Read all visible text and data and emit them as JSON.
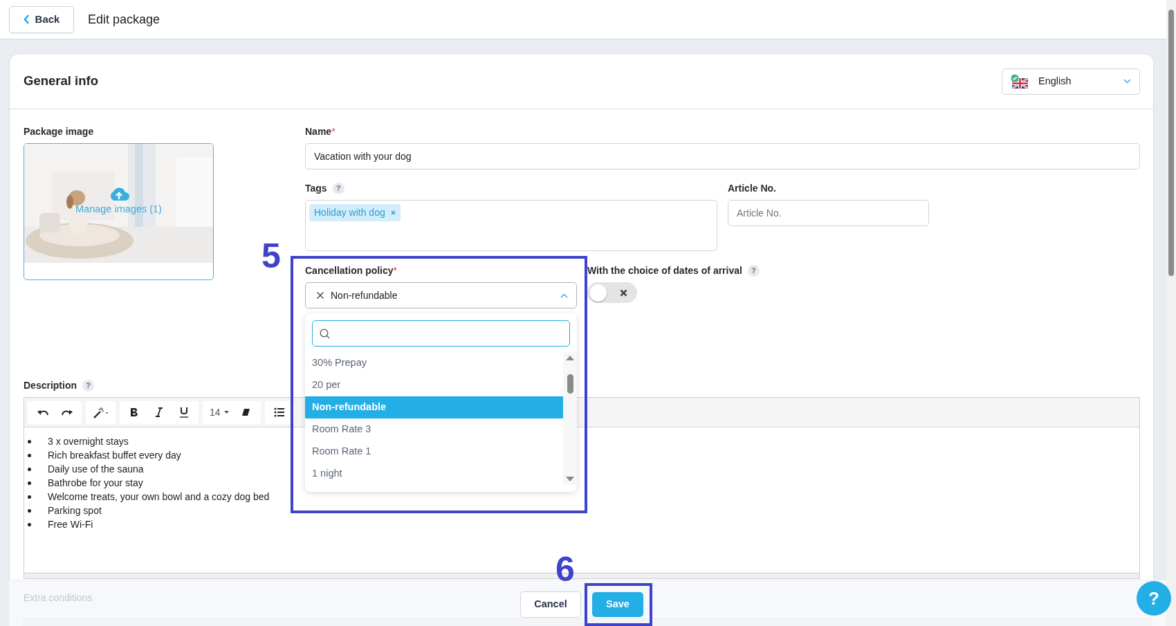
{
  "header": {
    "back_button": "Back",
    "title": "Edit package"
  },
  "card": {
    "title": "General info",
    "language": "English"
  },
  "package_image": {
    "label": "Package image",
    "link": "Manage images (1)"
  },
  "name": {
    "label": "Name",
    "required_mark": "*",
    "value": "Vacation with your dog"
  },
  "tags": {
    "label": "Tags",
    "help": "?",
    "items": [
      {
        "label": "Holiday with dog"
      }
    ]
  },
  "article": {
    "label": "Article No.",
    "placeholder": "Article No."
  },
  "cancellation": {
    "label": "Cancellation policy",
    "required_mark": "*",
    "value": "Non-refundable",
    "expanded": true,
    "options": [
      {
        "label": "30% Prepay",
        "selected": false
      },
      {
        "label": "20 per",
        "selected": false
      },
      {
        "label": "Non-refundable",
        "selected": true
      },
      {
        "label": "Room Rate 3",
        "selected": false
      },
      {
        "label": "Room Rate 1",
        "selected": false
      },
      {
        "label": "1 night",
        "selected": false
      }
    ]
  },
  "arrival_choice": {
    "label": "With the choice of dates of arrival",
    "help": "?",
    "on": false
  },
  "description": {
    "label": "Description",
    "help": "?",
    "font_size": "14",
    "items": [
      "3 x overnight stays",
      "Rich breakfast buffet every day",
      "Daily use of the sauna",
      "Bathrobe for your stay",
      "Welcome treats, your own bowl and a cozy dog bed",
      "Parking spot",
      "Free Wi-Fi"
    ]
  },
  "extra_conditions": {
    "label": "Extra conditions"
  },
  "buttons": {
    "cancel": "Cancel",
    "save": "Save"
  },
  "annotations": [
    {
      "label": "5"
    },
    {
      "label": "6"
    }
  ],
  "help_button": "?"
}
